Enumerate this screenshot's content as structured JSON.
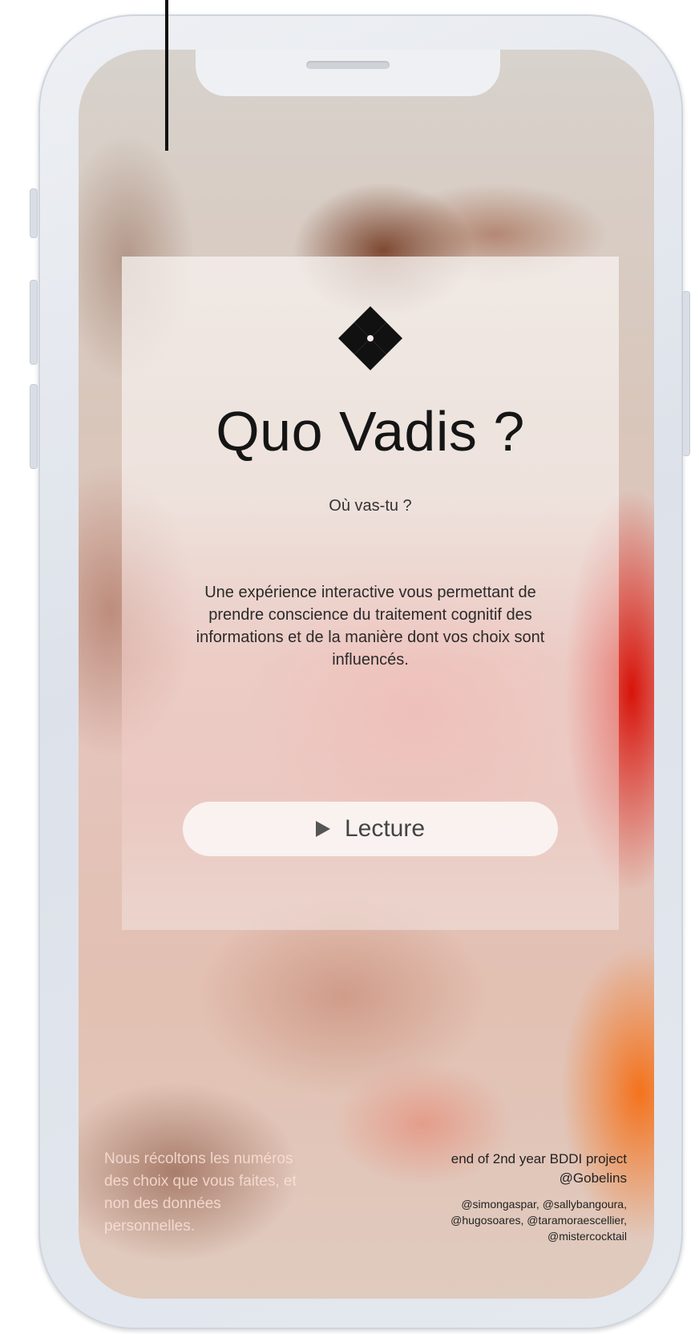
{
  "app": {
    "title": "Quo Vadis ?",
    "subtitle": "Où vas-tu ?",
    "description": "Une expérience interactive vous permettant de prendre conscience du traitement cognitif des informations et de la manière dont vos choix sont influencés.",
    "logo_icon": "diamond-logo-icon"
  },
  "play_button": {
    "label": "Lecture",
    "icon": "play-icon"
  },
  "footer": {
    "privacy_note": "Nous récoltons les numéros des choix que vous faites, et non des données personnelles.",
    "project_line": "end of 2nd year BDDI project",
    "school": "@Gobelins",
    "credits_line1": "@simongaspar, @sallybangoura,",
    "credits_line2": "@hugosoares, @taramoraescellier,",
    "credits_line3": "@mistercocktail"
  },
  "colors": {
    "accent_red": "#d70a00",
    "accent_orange": "#f56e14",
    "card_text": "#151515"
  }
}
